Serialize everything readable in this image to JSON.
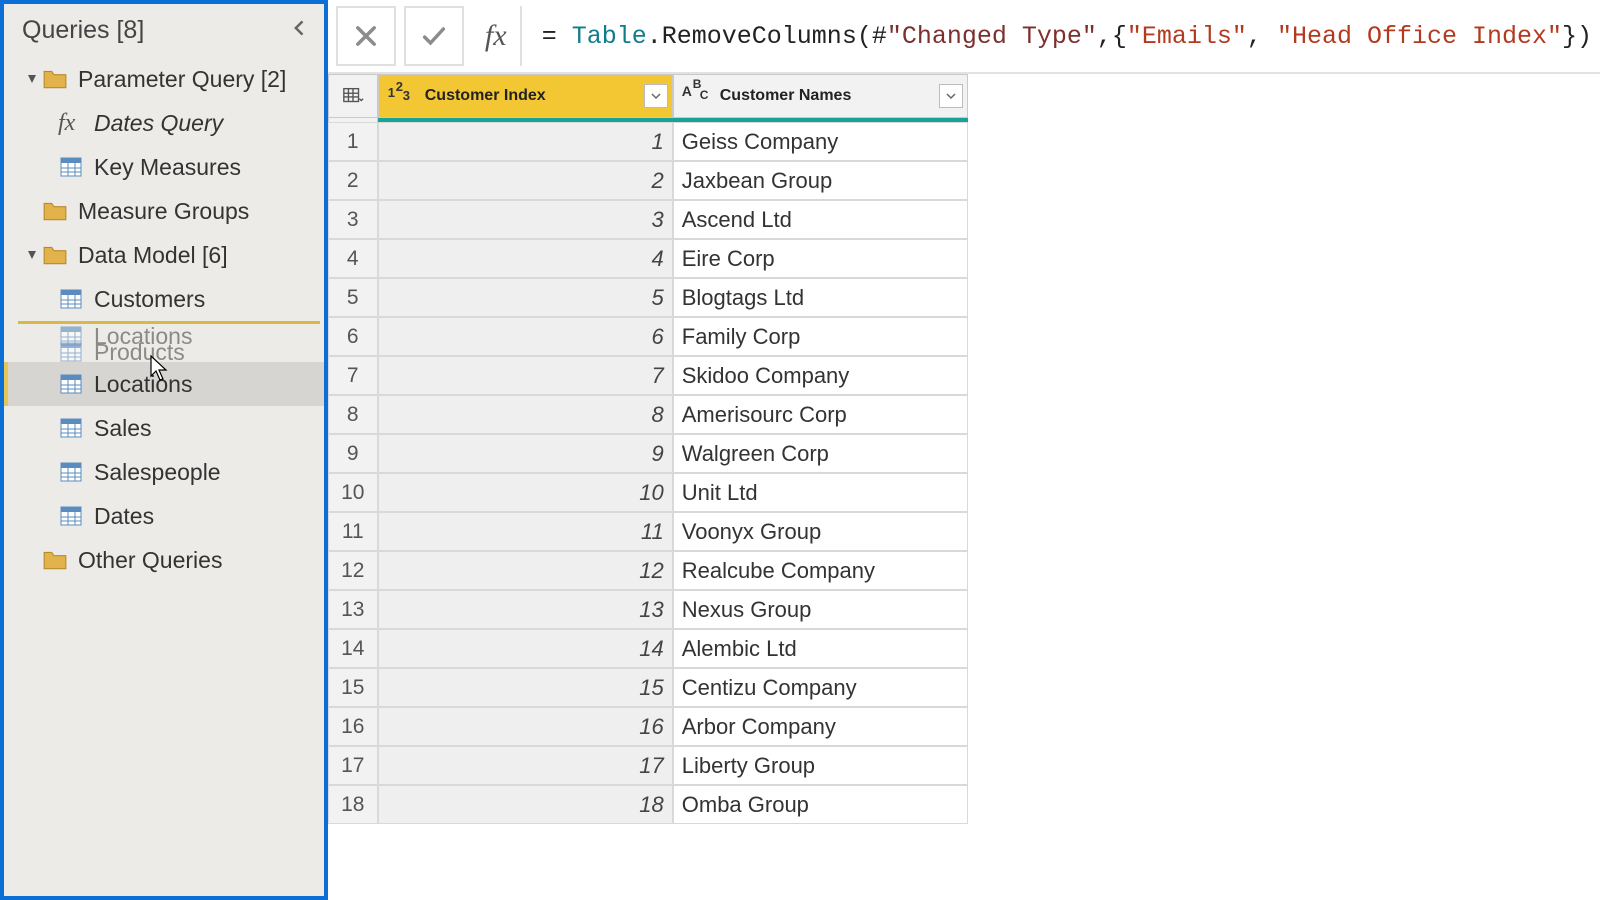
{
  "sidebar": {
    "title": "Queries [8]",
    "groups": [
      {
        "label": "Parameter Query [2]",
        "items": [
          {
            "label": "Dates Query",
            "type": "fx",
            "italic": true
          },
          {
            "label": "Key Measures",
            "type": "table"
          }
        ]
      },
      {
        "label": "Measure Groups",
        "type": "folder",
        "flat": true
      },
      {
        "label": "Data Model [6]",
        "items": [
          {
            "label": "Customers",
            "type": "table"
          },
          {
            "ghost_overlap": true,
            "ghost_top": "Locations",
            "ghost_bot": "Products"
          },
          {
            "label": "Locations",
            "type": "table",
            "selected": true
          },
          {
            "label": "Sales",
            "type": "table"
          },
          {
            "label": "Salespeople",
            "type": "table"
          },
          {
            "label": "Dates",
            "type": "table"
          }
        ]
      },
      {
        "label": "Other Queries",
        "type": "folder",
        "flat": true
      }
    ]
  },
  "formula": {
    "eq": "= ",
    "kw1": "Table",
    "fn": ".RemoveColumns(#",
    "step": "\"Changed Type\"",
    "mid": ",{",
    "col1": "\"Emails\"",
    "comma": ", ",
    "col2": "\"Head Office Index\"",
    "end": "})"
  },
  "table": {
    "columns": [
      {
        "name": "Customer Index",
        "type": "number"
      },
      {
        "name": "Customer Names",
        "type": "text"
      }
    ],
    "rows": [
      {
        "idx": 1,
        "name": "Geiss Company"
      },
      {
        "idx": 2,
        "name": "Jaxbean Group"
      },
      {
        "idx": 3,
        "name": "Ascend Ltd"
      },
      {
        "idx": 4,
        "name": "Eire Corp"
      },
      {
        "idx": 5,
        "name": "Blogtags Ltd"
      },
      {
        "idx": 6,
        "name": "Family Corp"
      },
      {
        "idx": 7,
        "name": "Skidoo Company"
      },
      {
        "idx": 8,
        "name": "Amerisourc Corp"
      },
      {
        "idx": 9,
        "name": "Walgreen Corp"
      },
      {
        "idx": 10,
        "name": "Unit Ltd"
      },
      {
        "idx": 11,
        "name": "Voonyx Group"
      },
      {
        "idx": 12,
        "name": "Realcube Company"
      },
      {
        "idx": 13,
        "name": "Nexus Group"
      },
      {
        "idx": 14,
        "name": "Alembic Ltd"
      },
      {
        "idx": 15,
        "name": "Centizu Company"
      },
      {
        "idx": 16,
        "name": "Arbor Company"
      },
      {
        "idx": 17,
        "name": "Liberty Group"
      },
      {
        "idx": 18,
        "name": "Omba Group"
      }
    ]
  }
}
